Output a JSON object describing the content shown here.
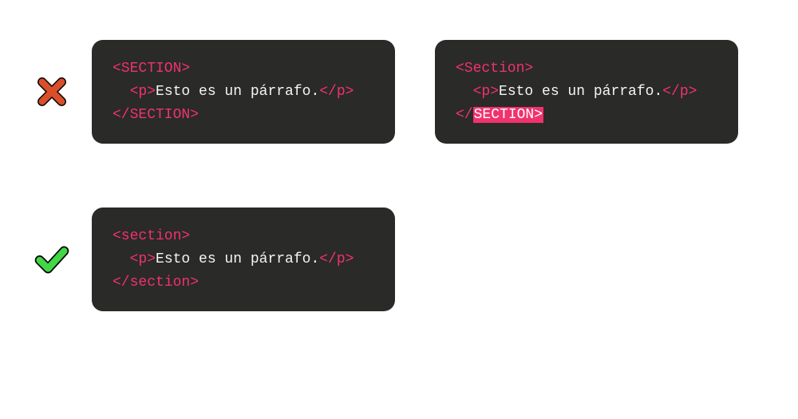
{
  "colors": {
    "tag": "#f0326e",
    "text": "#f5f5f5",
    "codeBg": "#2a2a28",
    "crossFill": "#d94f2a",
    "checkFill": "#41d746"
  },
  "icons": {
    "cross": "cross-icon",
    "check": "check-icon"
  },
  "bad": {
    "block1": {
      "l1_open": "<SECTION>",
      "l2_open": "<p>",
      "l2_text": "Esto es un párrafo.",
      "l2_close": "</p>",
      "l3_close": "</SECTION>"
    },
    "block2": {
      "l1_open": "<Section>",
      "l2_open": "<p>",
      "l2_text": "Esto es un párrafo.",
      "l2_close": "</p>",
      "l3_close_pre": "</",
      "l3_close_hl": "SECTION>"
    }
  },
  "good": {
    "block1": {
      "l1_open": "<section>",
      "l2_open": "<p>",
      "l2_text": "Esto es un párrafo.",
      "l2_close": "</p>",
      "l3_close": "</section>"
    }
  }
}
